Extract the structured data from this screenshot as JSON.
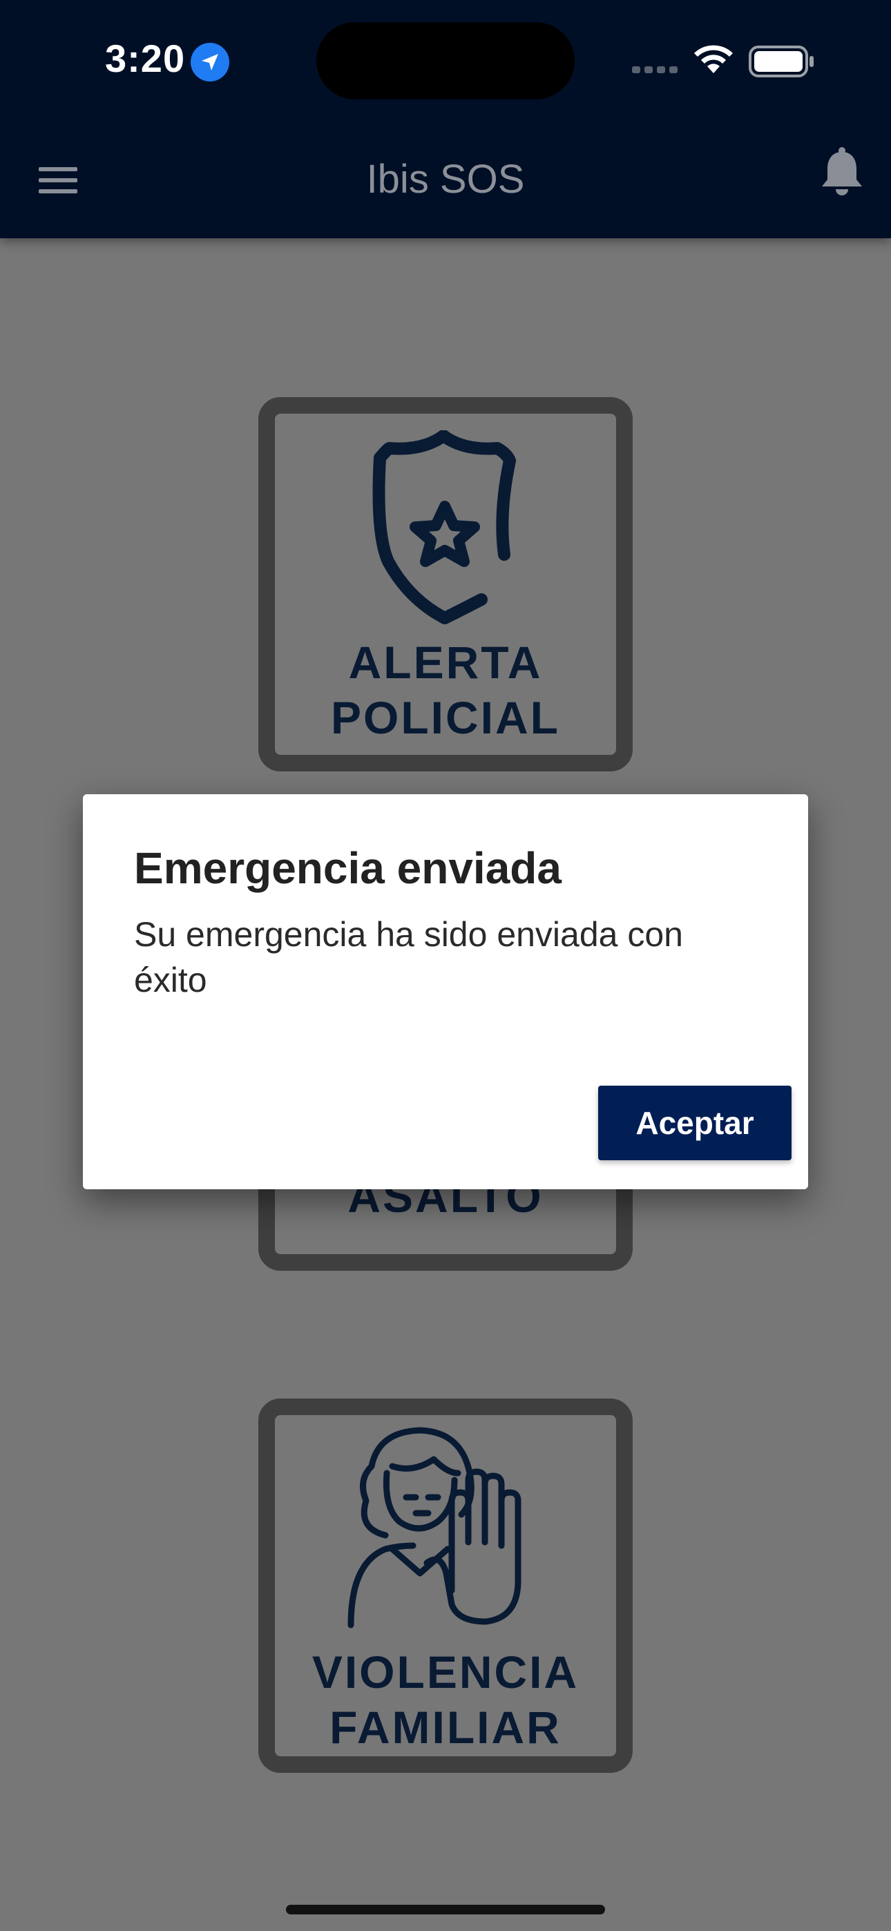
{
  "status_bar": {
    "time": "3:20",
    "icons": [
      "location-arrow-icon",
      "cellular-signal-icon",
      "wifi-icon",
      "battery-icon"
    ]
  },
  "app_bar": {
    "title": "Ibis SOS",
    "left_icon": "hamburger-menu-icon",
    "right_icon": "bell-icon"
  },
  "cards": [
    {
      "label_line1": "ALERTA",
      "label_line2": "POLICIAL",
      "icon": "police-badge-icon"
    },
    {
      "label_line1": "ASALTO",
      "icon": "robbery-icon"
    },
    {
      "label_line1": "VIOLENCIA",
      "label_line2": "FAMILIAR",
      "icon": "woman-stop-hand-icon"
    }
  ],
  "dialog": {
    "title": "Emergencia enviada",
    "body": "Su emergencia ha sido enviada con éxito",
    "button": "Aceptar"
  },
  "colors": {
    "app_bar": "#010f26",
    "overlay_background": "#777777",
    "card_border": "#3f3f3f",
    "icon_navy": "#091a33",
    "button": "#021f55"
  }
}
